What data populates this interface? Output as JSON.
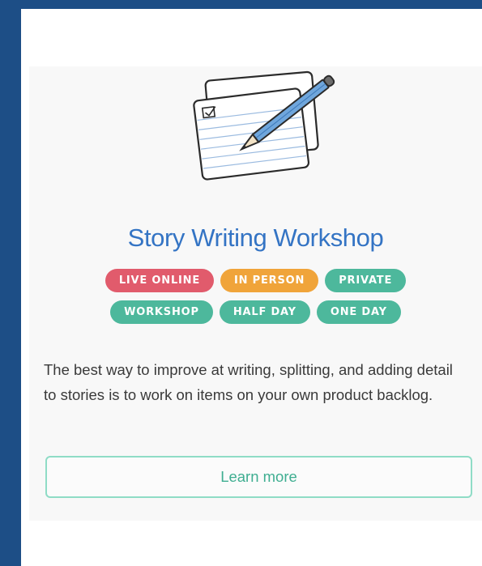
{
  "course": {
    "title": "Story Writing Workshop",
    "tags_row1": [
      {
        "label": "LIVE ONLINE",
        "color": "#e15b6c"
      },
      {
        "label": "IN PERSON",
        "color": "#f0a43a"
      },
      {
        "label": "PRIVATE",
        "color": "#4db89c"
      }
    ],
    "tags_row2": [
      {
        "label": "WORKSHOP",
        "color": "#4db89c"
      },
      {
        "label": "HALF DAY",
        "color": "#4db89c"
      },
      {
        "label": "ONE DAY",
        "color": "#4db89c"
      }
    ],
    "description": "The best way to improve at writing, splitting, and adding detail to stories is to work on items on your own product backlog.",
    "cta_label": "Learn more",
    "illustration_icon": "story-cards-pencil-icon"
  },
  "colors": {
    "page_background": "#1d4e86",
    "title": "#3474c4",
    "button_border": "#8fdcc6",
    "button_text": "#3fae91"
  }
}
